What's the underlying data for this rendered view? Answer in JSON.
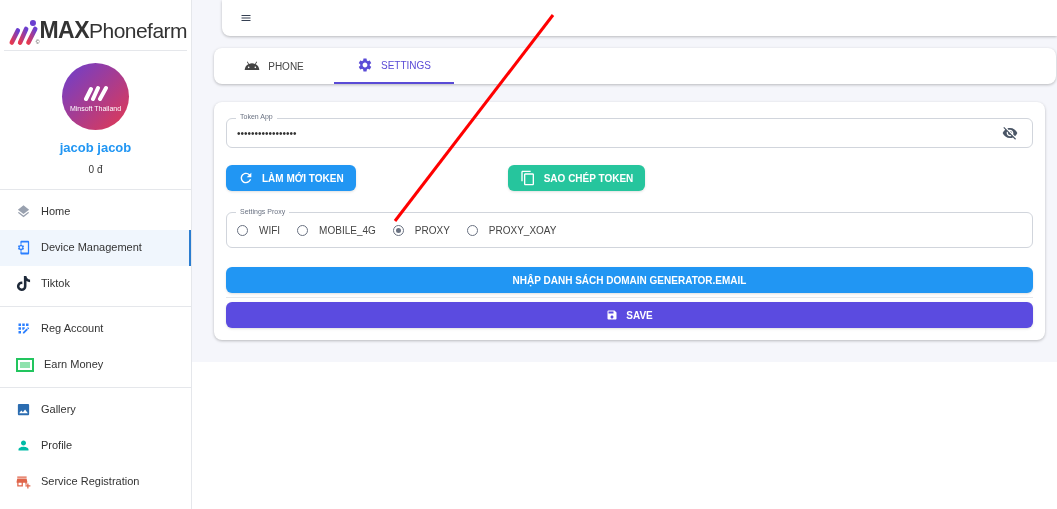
{
  "logo": {
    "bold": "MAX",
    "rest": "Phonefarm",
    "mark": "©"
  },
  "user": {
    "avatar_caption": "Minsoft Thailand",
    "name": "jacob jacob",
    "balance": "0 đ"
  },
  "sidebar": {
    "groups": [
      {
        "items": [
          {
            "label": "Home",
            "selected": false
          },
          {
            "label": "Device Management",
            "selected": true
          },
          {
            "label": "Tiktok",
            "selected": false
          }
        ]
      },
      {
        "items": [
          {
            "label": "Reg Account",
            "selected": false
          },
          {
            "label": "Earn Money",
            "selected": false
          }
        ]
      },
      {
        "items": [
          {
            "label": "Gallery",
            "selected": false
          },
          {
            "label": "Profile",
            "selected": false
          },
          {
            "label": "Service Registration",
            "selected": false
          }
        ]
      }
    ]
  },
  "tabs": [
    {
      "label": "PHONE",
      "selected": false
    },
    {
      "label": "SETTINGS",
      "selected": true
    }
  ],
  "token": {
    "label": "Token App",
    "value": "•••••••••••••••••"
  },
  "token_buttons": [
    "LÀM MỚI TOKEN",
    "SAO CHÉP TOKEN"
  ],
  "proxy": {
    "label": "Settings Proxy",
    "options": [
      {
        "label": "WIFI",
        "selected": false
      },
      {
        "label": "MOBILE_4G",
        "selected": false
      },
      {
        "label": "PROXY",
        "selected": true
      },
      {
        "label": "PROXY_XOAY",
        "selected": false
      }
    ]
  },
  "import_button": "NHẬP DANH SÁCH DOMAIN GENERATOR.EMAIL",
  "save_button": "SAVE"
}
